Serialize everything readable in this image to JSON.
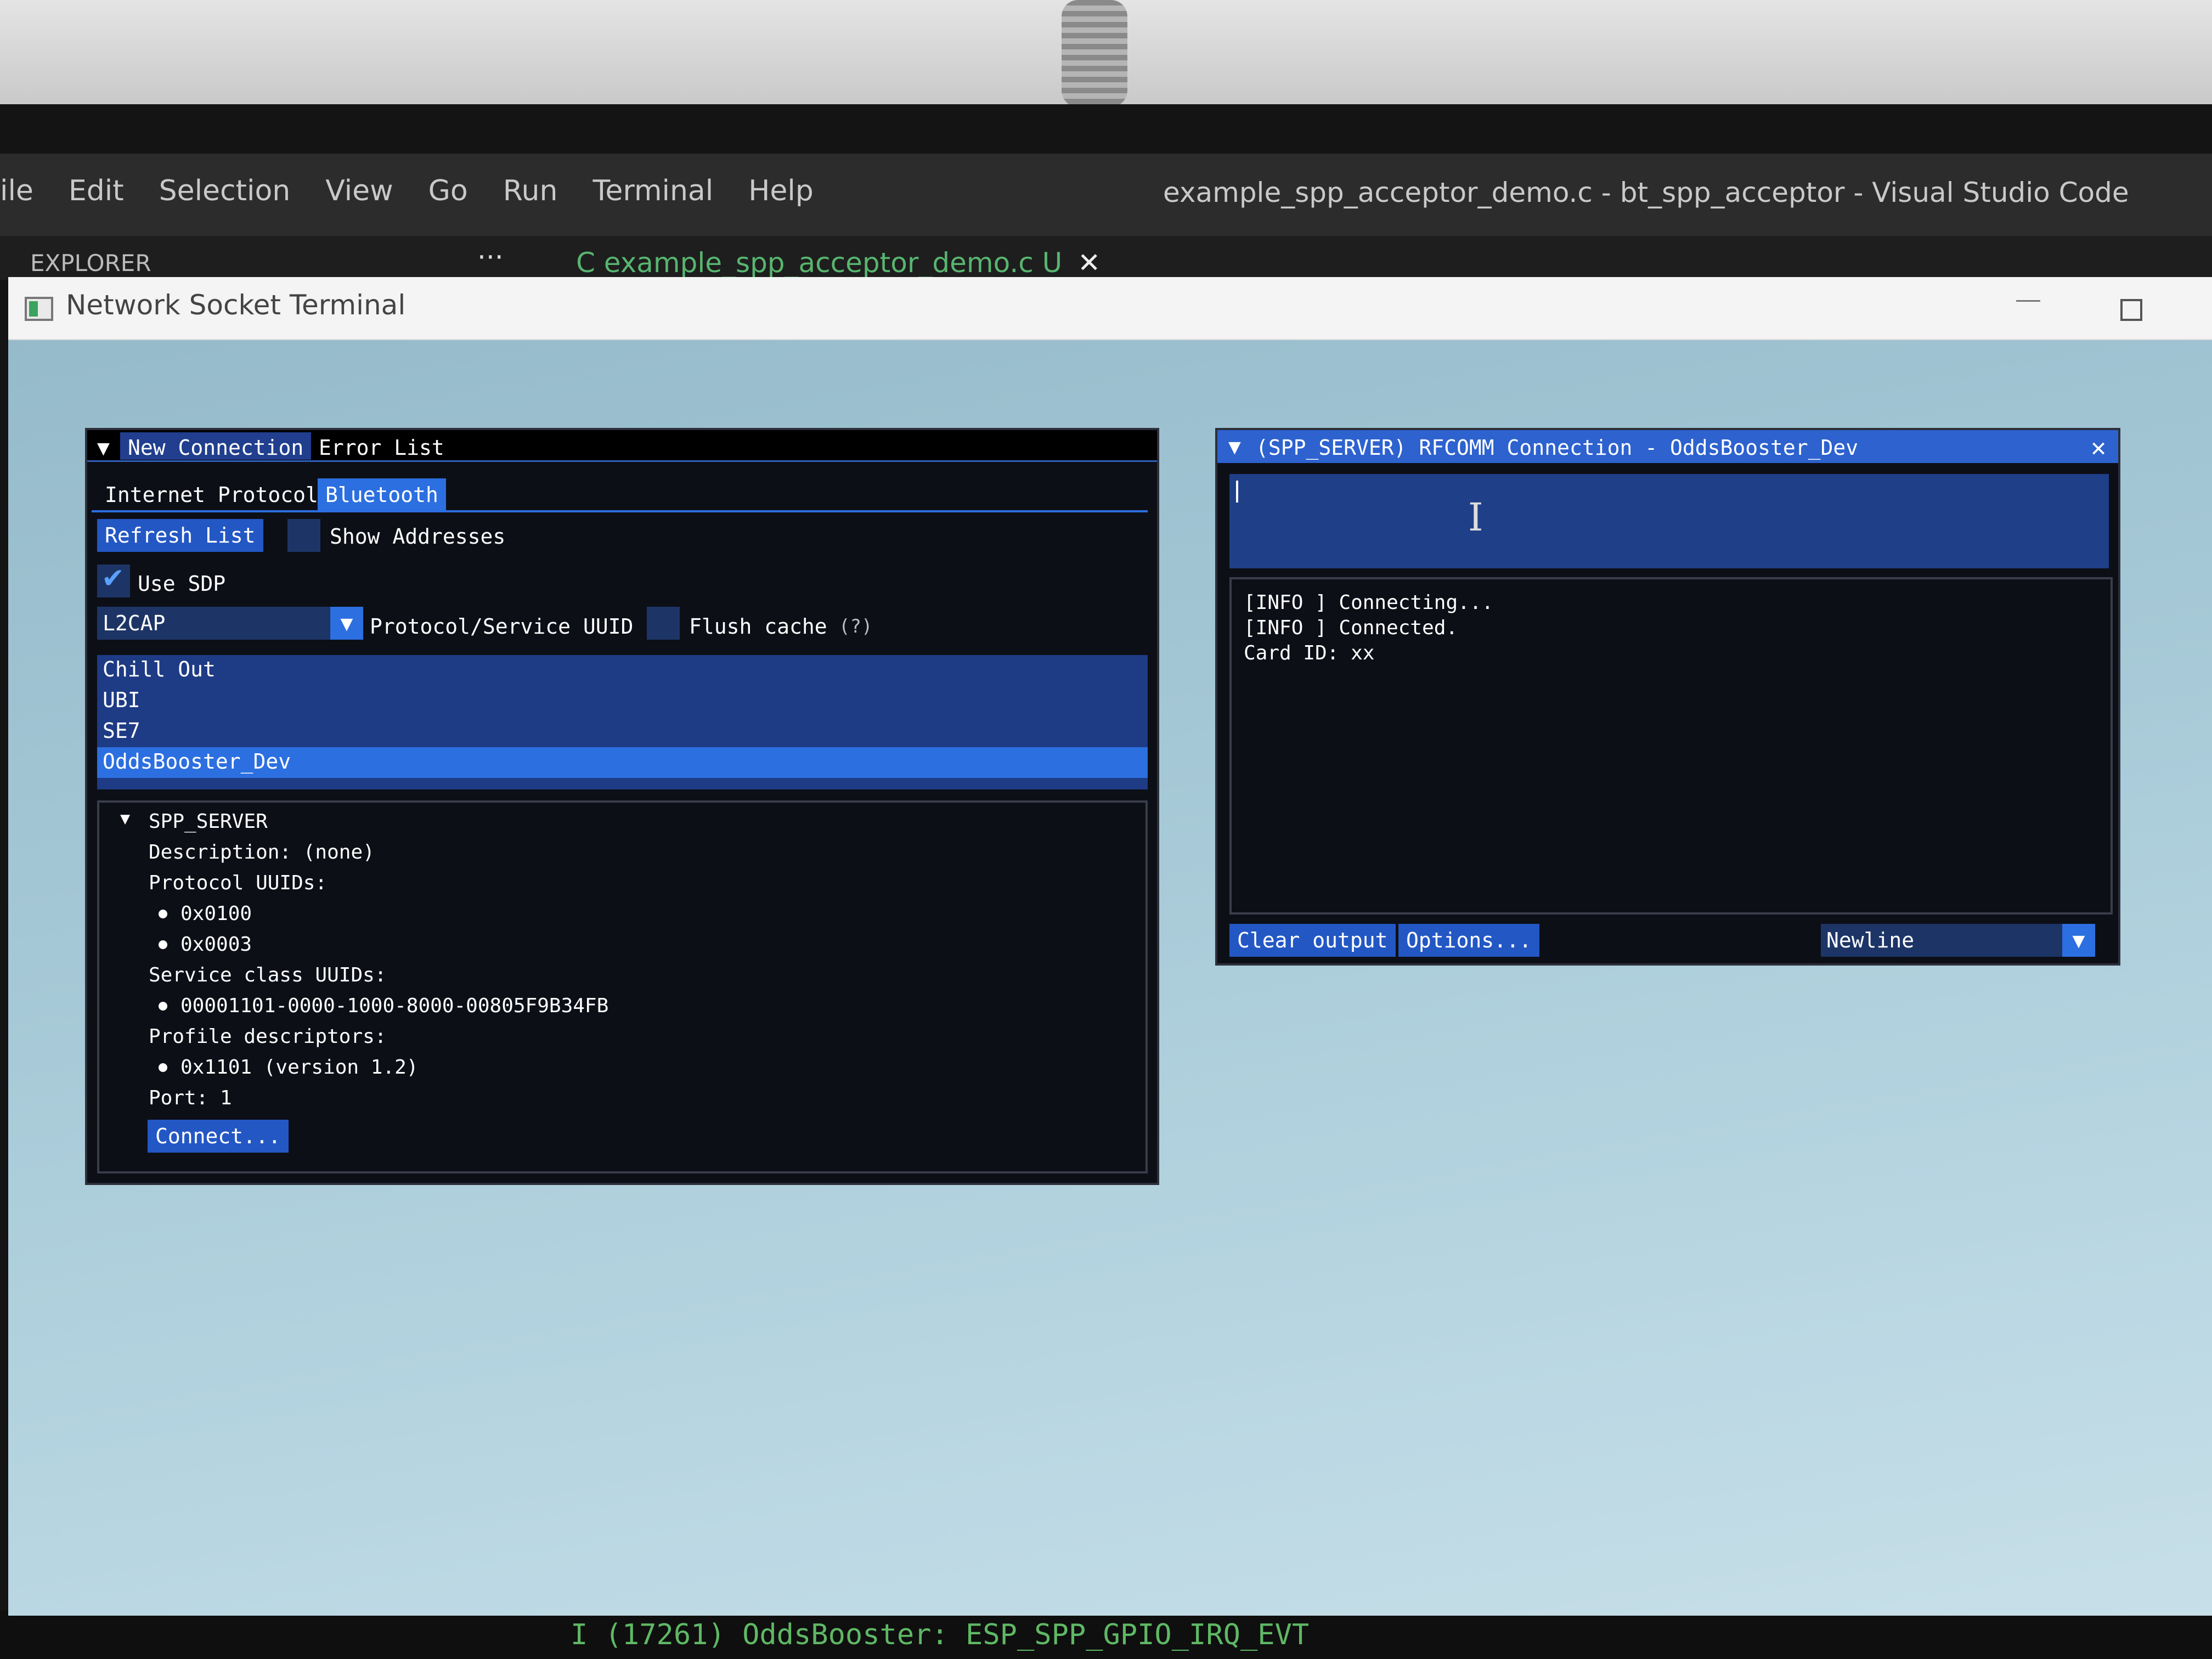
{
  "vscode": {
    "menu": [
      "ile",
      "Edit",
      "Selection",
      "View",
      "Go",
      "Run",
      "Terminal",
      "Help"
    ],
    "title": "example_spp_acceptor_demo.c - bt_spp_acceptor - Visual Studio Code",
    "explorer": "EXPLORER",
    "more_icon": "···",
    "tab_label": "C  example_spp_acceptor_demo.c U",
    "tab_close_icon": "✕",
    "bottom_text": "I (17261) OddsBooster: ESP_SPP_GPIO_IRQ_EVT"
  },
  "window": {
    "title": "Network Socket Terminal",
    "minimize_icon": "minimize",
    "maximize_icon": "maximize"
  },
  "left_panel": {
    "collapse_icon": "▼",
    "tabs": [
      "New Connection",
      "Error List"
    ],
    "subtabs": [
      "Internet Protocol",
      "Bluetooth"
    ],
    "refresh_label": "Refresh List",
    "show_addresses_label": "Show Addresses",
    "use_sdp_label": "Use SDP",
    "protocol_dropdown_value": "L2CAP",
    "protocol_uuid_label": "Protocol/Service UUID",
    "flush_cache_label": "Flush cache",
    "help_marker": "(?)",
    "devices": [
      "Chill Out",
      "UBI",
      "SE7",
      "OddsBooster_Dev"
    ],
    "service": {
      "name": "SPP_SERVER",
      "description": "Description: (none)",
      "protocol_uuids_label": "Protocol UUIDs:",
      "protocol_uuids": [
        "0x0100",
        "0x0003"
      ],
      "service_class_label": "Service class UUIDs:",
      "service_class_uuids": [
        "00001101-0000-1000-8000-00805F9B34FB"
      ],
      "profile_label": "Profile descriptors:",
      "profiles": [
        "0x1101 (version 1.2)"
      ],
      "port": "Port: 1",
      "connect_label": "Connect..."
    }
  },
  "right_panel": {
    "collapse_icon": "▼",
    "title": "(SPP_SERVER) RFCOMM Connection - OddsBooster_Dev",
    "close_icon": "✕",
    "ibeam": "I",
    "output": [
      "[INFO ] Connecting...",
      "[INFO ] Connected.",
      "Card ID: xx"
    ],
    "clear_label": "Clear output",
    "options_label": "Options...",
    "newline_value": "Newline",
    "dropdown_arrow": "▼"
  },
  "colors": {
    "accent": "#2c6fe0",
    "panel_bg": "#0d0f17",
    "app_bg": "#a5c8d6"
  }
}
